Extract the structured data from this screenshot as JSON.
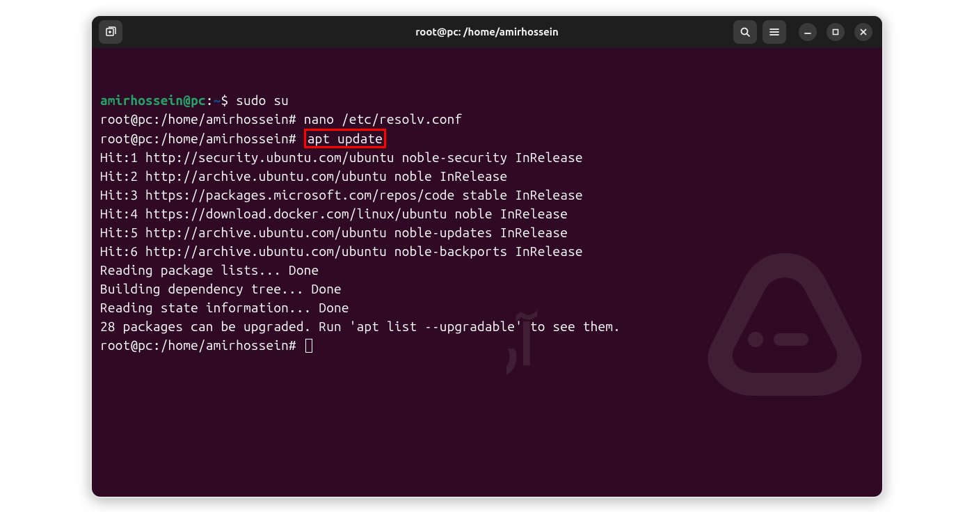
{
  "titlebar": {
    "title": "root@pc: /home/amirhossein"
  },
  "terminal": {
    "lines": [
      {
        "type": "user-prompt",
        "user": "amirhossein",
        "host": "pc",
        "path": "~",
        "symbol": "$",
        "command": "sudo su"
      },
      {
        "type": "root-prompt",
        "prompt": "root@pc:/home/amirhossein#",
        "command": "nano /etc/resolv.conf"
      },
      {
        "type": "root-prompt-highlight",
        "prompt": "root@pc:/home/amirhossein#",
        "command": "apt update"
      },
      {
        "type": "output",
        "text": "Hit:1 http://security.ubuntu.com/ubuntu noble-security InRelease"
      },
      {
        "type": "output",
        "text": "Hit:2 http://archive.ubuntu.com/ubuntu noble InRelease"
      },
      {
        "type": "output",
        "text": "Hit:3 https://packages.microsoft.com/repos/code stable InRelease"
      },
      {
        "type": "output",
        "text": "Hit:4 https://download.docker.com/linux/ubuntu noble InRelease"
      },
      {
        "type": "output",
        "text": "Hit:5 http://archive.ubuntu.com/ubuntu noble-updates InRelease"
      },
      {
        "type": "output",
        "text": "Hit:6 http://archive.ubuntu.com/ubuntu noble-backports InRelease"
      },
      {
        "type": "output",
        "text": "Reading package lists... Done"
      },
      {
        "type": "output",
        "text": "Building dependency tree... Done"
      },
      {
        "type": "output",
        "text": "Reading state information... Done"
      },
      {
        "type": "output",
        "text": "28 packages can be upgraded. Run 'apt list --upgradable' to see them."
      },
      {
        "type": "root-prompt-cursor",
        "prompt": "root@pc:/home/amirhossein#"
      }
    ]
  }
}
